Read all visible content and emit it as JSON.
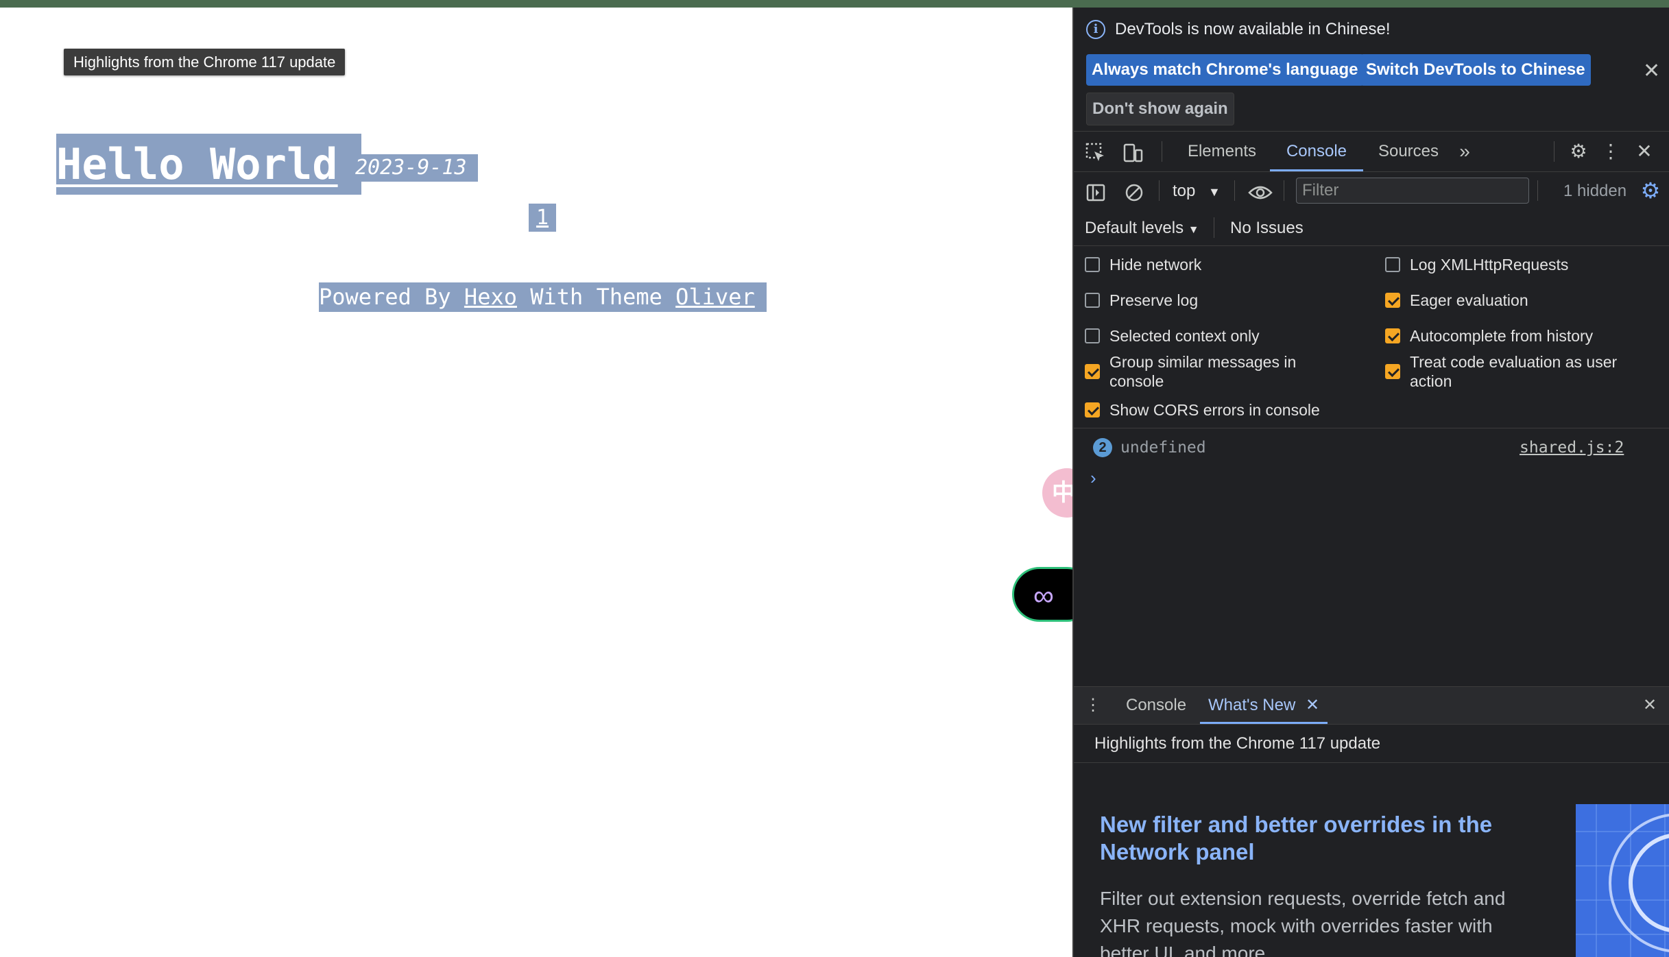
{
  "page": {
    "tooltip": "Highlights from the Chrome 117 update",
    "title": "Hello World",
    "date": "2023-9-13",
    "pagination_current": "1",
    "footer": {
      "powered_by": "Powered By ",
      "hexo": "Hexo",
      "with_theme": " With Theme ",
      "oliver": "Oliver"
    },
    "zh_bubble": "中",
    "infinity_button": "∞"
  },
  "devtools": {
    "banner": {
      "message": "DevTools is now available in Chinese!",
      "btn_match": "Always match Chrome's language",
      "btn_switch": "Switch DevTools to Chinese",
      "btn_dont_show": "Don't show again"
    },
    "tabs": [
      {
        "label": "Elements"
      },
      {
        "label": "Console",
        "active": true
      },
      {
        "label": "Sources"
      }
    ],
    "console_toolbar": {
      "context": "top",
      "filter_placeholder": "Filter",
      "hidden_count": "1 hidden",
      "levels": "Default levels",
      "issues": "No Issues"
    },
    "settings": [
      {
        "label": "Hide network",
        "checked": false
      },
      {
        "label": "Log XMLHttpRequests",
        "checked": false
      },
      {
        "label": "Preserve log",
        "checked": false
      },
      {
        "label": "Eager evaluation",
        "checked": true
      },
      {
        "label": "Selected context only",
        "checked": false
      },
      {
        "label": "Autocomplete from history",
        "checked": true
      },
      {
        "label": "Group similar messages in console",
        "checked": true
      },
      {
        "label": "Treat code evaluation as user action",
        "checked": true
      },
      {
        "label": "Show CORS errors in console",
        "checked": true
      }
    ],
    "console_messages": [
      {
        "count": "2",
        "text": "undefined",
        "source": "shared.js:2"
      }
    ],
    "drawer": {
      "tabs": [
        {
          "label": "Console"
        },
        {
          "label": "What's New",
          "active": true
        }
      ],
      "whats_new_header": "Highlights from the Chrome 117 update",
      "article_title": "New filter and better overrides in the Network panel",
      "article_desc": "Filter out extension requests, override fetch and XHR requests, mock with overrides faster with better UI, and more."
    },
    "colors": {
      "accent": "#7cacf8",
      "checkbox_on": "#f5a623",
      "button_blue": "#2f6ac0",
      "selection": "#8aa0c2"
    }
  }
}
